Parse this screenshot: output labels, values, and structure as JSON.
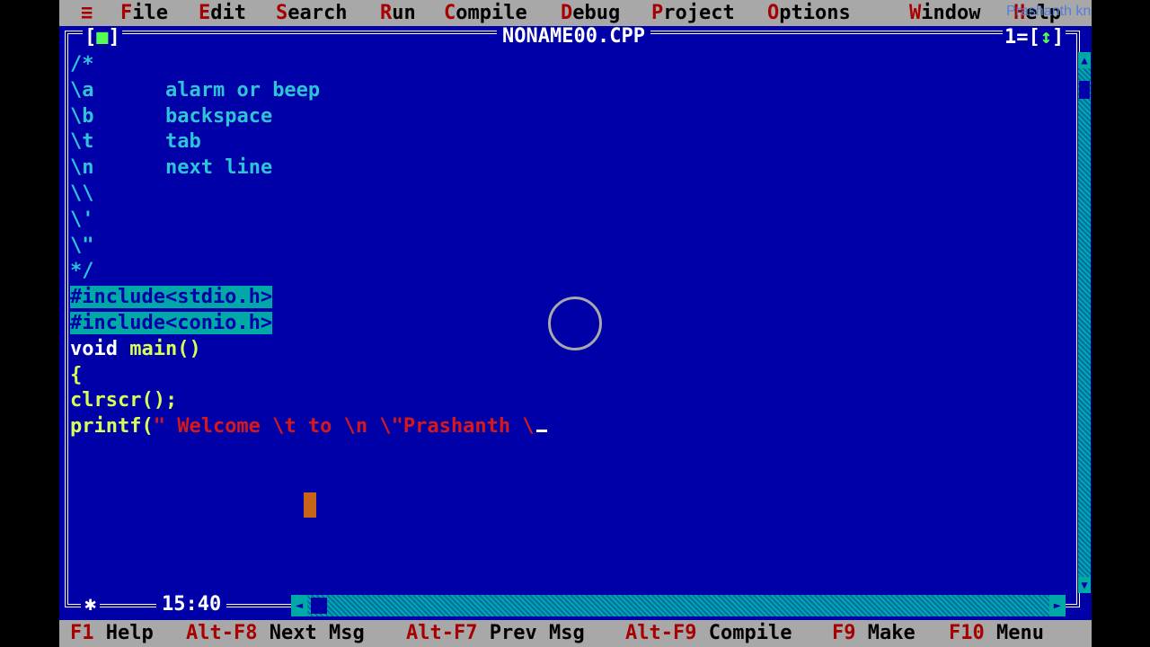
{
  "menu": {
    "system_icon": "≡",
    "items": [
      {
        "hot": "F",
        "rest": "ile"
      },
      {
        "hot": "E",
        "rest": "dit"
      },
      {
        "hot": "S",
        "rest": "earch"
      },
      {
        "hot": "R",
        "rest": "un"
      },
      {
        "hot": "C",
        "rest": "ompile"
      },
      {
        "hot": "D",
        "rest": "ebug"
      },
      {
        "hot": "P",
        "rest": "roject"
      },
      {
        "hot": "O",
        "rest": "ptions"
      },
      {
        "hot": "W",
        "rest": "indow"
      },
      {
        "hot": "H",
        "rest": "elp"
      }
    ]
  },
  "watermark": "Prashanth knowledge center",
  "window": {
    "title": "NONAME00.CPP",
    "close_box": "[■]",
    "number": "1",
    "zoom_box": "[↕]",
    "position": "15:40",
    "star": "✱"
  },
  "code": {
    "comment_open": "/*",
    "escapes": [
      {
        "seq": "\\a",
        "desc": "alarm or beep"
      },
      {
        "seq": "\\b",
        "desc": "backspace"
      },
      {
        "seq": "\\t",
        "desc": "tab"
      },
      {
        "seq": "\\n",
        "desc": "next line"
      }
    ],
    "escape_backslash": "\\\\",
    "escape_quote": "\\'",
    "escape_dquote": "\\\"",
    "comment_close": "*/",
    "include1": "#include<stdio.h>",
    "include2": "#include<conio.h>",
    "void_kw": "void",
    "main_decl": " main()",
    "brace": "{",
    "clrscr": "clrscr();",
    "printf_fn": "printf(",
    "printf_str": "\" Welcome \\t to \\n \\\"Prashanth \\"
  },
  "fkeys": [
    {
      "key": "F1",
      "label": " Help"
    },
    {
      "key": "Alt-F8",
      "label": " Next Msg"
    },
    {
      "key": "Alt-F7",
      "label": " Prev Msg"
    },
    {
      "key": "Alt-F9",
      "label": " Compile"
    },
    {
      "key": "F9",
      "label": " Make"
    },
    {
      "key": "F10",
      "label": " Menu"
    }
  ],
  "colors": {
    "editor_bg": "#0000a8",
    "menu_bg": "#a8a8a8",
    "hotkey": "#a80000",
    "comment": "#2ec4d8",
    "string": "#d81818",
    "identifier": "#d8ff54",
    "selection": "#00a8a8"
  }
}
